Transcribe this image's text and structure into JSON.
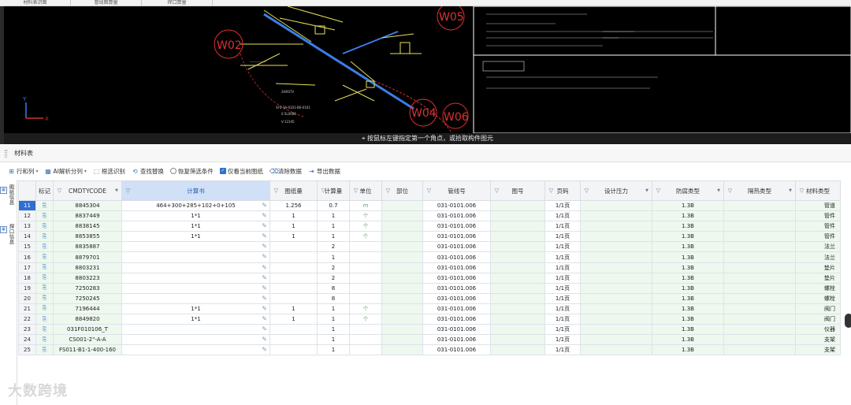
{
  "top_tabs": [
    "材料表识图",
    "管线图算量",
    "焊口算量"
  ],
  "cad": {
    "labels": [
      "W05",
      "W02",
      "W04",
      "W06"
    ],
    "status_text": "按鼠标左键指定第一个角点，或拾取构件图元"
  },
  "panel": {
    "title": "材料表"
  },
  "toolbar": {
    "rows_cols": "行和列",
    "ai_split": "AI解析分列",
    "box_select": "框选识别",
    "find_replace": "查找替换",
    "restore_filter": "恢复筛选条件",
    "only_current": "仅看当前图纸",
    "clear_data": "清除数据",
    "export_data": "导出数据"
  },
  "sidebar": {
    "tab1": "图纸信息",
    "tab2": "焊口信息"
  },
  "table": {
    "headers": [
      "",
      "标记",
      "CMDTYCODE",
      "计算书",
      "图纸量",
      "计算量",
      "单位",
      "部位",
      "管线号",
      "图号",
      "页码",
      "设计压力",
      "防腐类型",
      "隔热类型",
      "材料类型"
    ],
    "rows": [
      {
        "no": "11",
        "code": "8845304",
        "calc": "464+300+285+102+0+105",
        "drawing_qty": "1.256",
        "calc_qty": "0.7",
        "unit": "m",
        "line": "031-0101.006",
        "page": "1/1页",
        "anti": "1.3B",
        "mat": "管道"
      },
      {
        "no": "12",
        "code": "8837449",
        "calc": "1*1",
        "drawing_qty": "1",
        "calc_qty": "1",
        "unit": "个",
        "line": "031-0101.006",
        "page": "1/1页",
        "anti": "1.3B",
        "mat": "管件"
      },
      {
        "no": "13",
        "code": "8838145",
        "calc": "1*1",
        "drawing_qty": "1",
        "calc_qty": "1",
        "unit": "个",
        "line": "031-0101.006",
        "page": "1/1页",
        "anti": "1.3B",
        "mat": "管件"
      },
      {
        "no": "14",
        "code": "8853855",
        "calc": "1*1",
        "drawing_qty": "1",
        "calc_qty": "1",
        "unit": "个",
        "line": "031-0101.006",
        "page": "1/1页",
        "anti": "1.3B",
        "mat": "管件"
      },
      {
        "no": "15",
        "code": "8835887",
        "calc": "",
        "drawing_qty": "",
        "calc_qty": "2",
        "unit": "",
        "line": "031-0101.006",
        "page": "1/1页",
        "anti": "1.3B",
        "mat": "法兰"
      },
      {
        "no": "16",
        "code": "8879701",
        "calc": "",
        "drawing_qty": "",
        "calc_qty": "1",
        "unit": "",
        "line": "031-0101.006",
        "page": "1/1页",
        "anti": "1.3B",
        "mat": "法兰"
      },
      {
        "no": "17",
        "code": "8803231",
        "calc": "",
        "drawing_qty": "",
        "calc_qty": "2",
        "unit": "",
        "line": "031-0101.006",
        "page": "1/1页",
        "anti": "1.3B",
        "mat": "垫片"
      },
      {
        "no": "18",
        "code": "8803223",
        "calc": "",
        "drawing_qty": "",
        "calc_qty": "2",
        "unit": "",
        "line": "031-0101.006",
        "page": "1/1页",
        "anti": "1.3B",
        "mat": "垫片"
      },
      {
        "no": "19",
        "code": "7250283",
        "calc": "",
        "drawing_qty": "",
        "calc_qty": "8",
        "unit": "",
        "line": "031-0101.006",
        "page": "1/1页",
        "anti": "1.3B",
        "mat": "螺栓"
      },
      {
        "no": "20",
        "code": "7250245",
        "calc": "",
        "drawing_qty": "",
        "calc_qty": "8",
        "unit": "",
        "line": "031-0101.006",
        "page": "1/1页",
        "anti": "1.3B",
        "mat": "螺栓"
      },
      {
        "no": "21",
        "code": "7196444",
        "calc": "1*1",
        "drawing_qty": "1",
        "calc_qty": "1",
        "unit": "个",
        "line": "031-0101.006",
        "page": "1/1页",
        "anti": "1.3B",
        "mat": "阀门"
      },
      {
        "no": "22",
        "code": "8849820",
        "calc": "1*1",
        "drawing_qty": "1",
        "calc_qty": "1",
        "unit": "个",
        "line": "031-0101.006",
        "page": "1/1页",
        "anti": "1.3B",
        "mat": "阀门"
      },
      {
        "no": "23",
        "code": "031F010106_T",
        "calc": "",
        "drawing_qty": "",
        "calc_qty": "1",
        "unit": "",
        "line": "031-0101.006",
        "page": "1/1页",
        "anti": "1.3B",
        "mat": "仪器"
      },
      {
        "no": "24",
        "code": "CS001-2\"-A-A",
        "calc": "",
        "drawing_qty": "",
        "calc_qty": "1",
        "unit": "",
        "line": "031-0101.006",
        "page": "1/1页",
        "anti": "1.3B",
        "mat": "支架"
      },
      {
        "no": "25",
        "code": "FS011-B1-1-400-160",
        "calc": "",
        "drawing_qty": "",
        "calc_qty": "1",
        "unit": "",
        "line": "031-0101.006",
        "page": "1/1页",
        "anti": "1.3B",
        "mat": "支架"
      }
    ]
  },
  "watermark": "大数跨境"
}
